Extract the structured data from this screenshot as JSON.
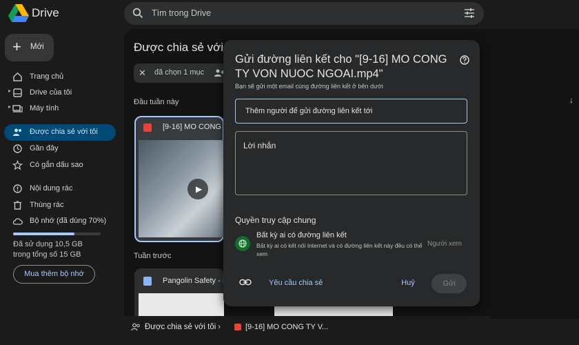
{
  "app": {
    "brand": "Drive"
  },
  "search": {
    "placeholder": "Tìm trong Drive"
  },
  "sidebar": {
    "new_label": "Mới",
    "items": [
      {
        "label": "Trang chủ"
      },
      {
        "label": "Drive của tôi"
      },
      {
        "label": "Máy tính"
      },
      {
        "label": "Được chia sẻ với tôi"
      },
      {
        "label": "Gần đây"
      },
      {
        "label": "Có gắn dấu sao"
      },
      {
        "label": "Nội dung rác"
      },
      {
        "label": "Thùng rác"
      },
      {
        "label": "Bộ nhớ (đã dùng 70%)"
      }
    ],
    "storage_used_text": "Đã sử dụng 10,5 GB trong tổng số 15 GB",
    "storage_fraction": 0.7,
    "buy_storage": "Mua thêm bộ nhớ"
  },
  "main": {
    "title": "Được chia sẻ với",
    "selection_chip": "đã chọn 1 mục",
    "section_this_week": "Đầu tuần này",
    "section_last_week": "Tuần trước",
    "card1_title": "[9-16] MO CONG T",
    "card2_title": "Pangolin Safety - I"
  },
  "breadcrumb": {
    "shared": "Được chia sẻ với tôi",
    "file": "[9-16] MO CONG TY V..."
  },
  "modal": {
    "title": "Gửi đường liên kết cho \"[9-16] MO CONG TY VON NUOC NGOAI.mp4\"",
    "subtitle": "Bạn sẽ gửi một email cùng đường liên kết ở bên dưới",
    "recipients_placeholder": "Thêm người để gửi đường liên kết tới",
    "message_placeholder": "Lời nhắn",
    "access_heading": "Quyền truy cập chung",
    "access_name": "Bất kỳ ai có đường liên kết",
    "access_desc": "Bất kỳ ai có kết nối Internet và có đường liên kết này đều có thể xem",
    "access_role": "Người xem",
    "request_access": "Yêu cầu chia sẻ",
    "cancel": "Huỷ",
    "send": "Gửi"
  },
  "colors": {
    "accent": "#a8c7fa",
    "active_nav": "#004a77",
    "globe": "#146c2e"
  }
}
